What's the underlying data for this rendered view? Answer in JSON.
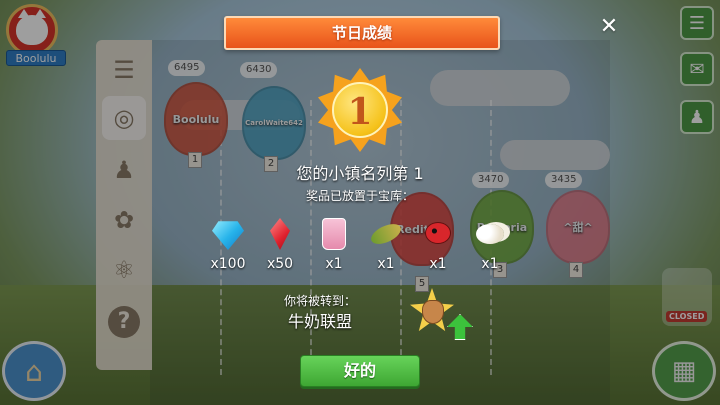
{
  "player": {
    "name": "Boolulu"
  },
  "leaderboard": {
    "title_partial": "节日",
    "bottom_button_partial": "奖品",
    "scores": [
      "6495",
      "6430",
      "3470",
      "3435"
    ],
    "balloons": [
      {
        "name": "Boolulu",
        "rank": "1",
        "color": "#d7533b"
      },
      {
        "name": "CarolWaite642",
        "rank": "2",
        "color": "#4aa3c4"
      },
      {
        "name": "Reditmo",
        "rank": "5",
        "color": "#e1433d"
      },
      {
        "name": "Pretoria",
        "rank": "3",
        "color": "#72ad3a"
      },
      {
        "name": "^甜^",
        "rank": "4",
        "color": "#e97d8c"
      }
    ]
  },
  "dialog": {
    "title": "节日成绩",
    "medal_rank": "1",
    "rank_text": "您的小镇名列第 1",
    "reward_text": "奖品已放置于宝库：",
    "rewards": [
      {
        "icon": "blue-diamond-icon",
        "qty": "x100"
      },
      {
        "icon": "red-ruby-icon",
        "qty": "x50"
      },
      {
        "icon": "seed-bag-icon",
        "qty": "x1"
      },
      {
        "icon": "corn-leaf-icon",
        "qty": "x1"
      },
      {
        "icon": "ladybug-icon",
        "qty": "x1"
      },
      {
        "icon": "eggs-icon",
        "qty": "x1"
      }
    ],
    "transfer_label": "你将被转到：",
    "league_name": "牛奶联盟",
    "ok_label": "好的"
  },
  "side": {
    "closed_label": "CLOSED"
  },
  "colors": {
    "ribbon": "#e8531a",
    "ok_button": "#4fbd41",
    "accent_blue": "#2f7fc7"
  }
}
